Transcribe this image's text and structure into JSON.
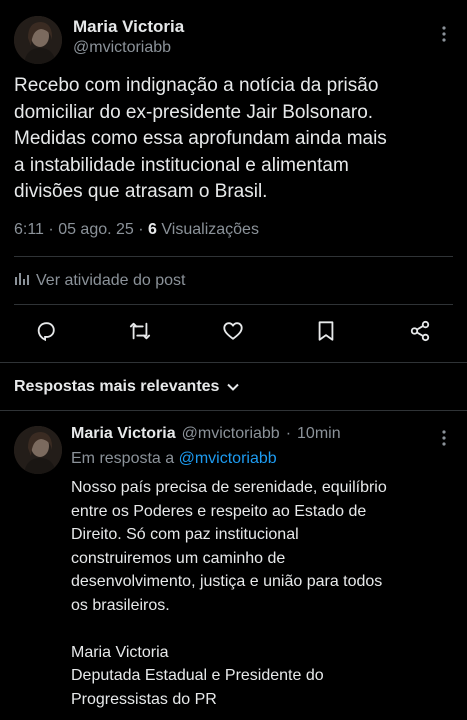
{
  "tweet": {
    "author_name": "Maria Victoria",
    "author_handle": "@mvictoriabb",
    "text": "Recebo com indignação a notícia da prisão\ndomiciliar do ex-presidente Jair Bolsonaro.\nMedidas como essa aprofundam ainda mais\na instabilidade institucional e alimentam\ndivisões que atrasam o Brasil.",
    "time": "6:11",
    "date": "05 ago. 25",
    "views_count": "6",
    "views_label": "Visualizações",
    "separator": "·"
  },
  "activity": {
    "label": "Ver atividade do post",
    "icon": "stats-icon"
  },
  "actions": [
    {
      "name": "reply",
      "icon": "reply-icon"
    },
    {
      "name": "repost",
      "icon": "repost-icon"
    },
    {
      "name": "like",
      "icon": "heart-icon"
    },
    {
      "name": "bookmark",
      "icon": "bookmark-icon"
    },
    {
      "name": "share",
      "icon": "share-icon"
    }
  ],
  "replies_section": {
    "sort_label": "Respostas mais relevantes"
  },
  "reply": {
    "author_name": "Maria Victoria",
    "author_handle": "@mvictoriabb",
    "separator": "·",
    "time": "10min",
    "reply_prefix": "Em resposta a",
    "reply_to_handle": "@mvictoriabb",
    "text": "Nosso país precisa de serenidade, equilíbrio\nentre os Poderes e respeito ao Estado de\nDireito. Só com paz institucional\nconstruiremos um caminho de\ndesenvolvimento, justiça e união para todos\nos brasileiros.\n\nMaria Victoria\nDeputada Estadual e Presidente do\nProgressistas do PR"
  },
  "colors": {
    "background": "#000000",
    "text_primary": "#e7e9ea",
    "text_secondary": "#8b9299",
    "accent": "#1d9bf0",
    "divider": "#2f3336"
  }
}
